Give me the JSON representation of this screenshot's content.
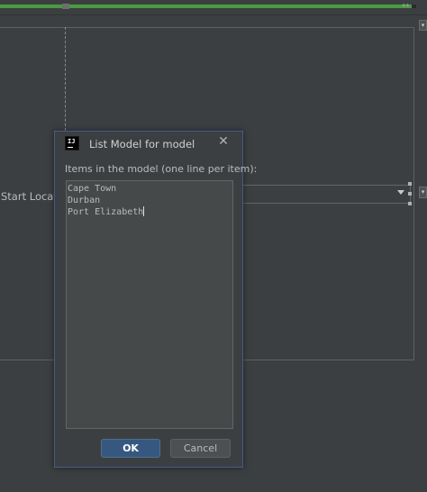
{
  "progress": {
    "fraction": 0.99
  },
  "dialog": {
    "title": "List Model for model",
    "app_icon_text": "IJ",
    "items_label": "Items in the model (one line per item):",
    "items_lines": [
      "Cape Town",
      "Durban",
      "Port Elizabeth"
    ],
    "ok_label": "OK",
    "cancel_label": "Cancel",
    "close_icon": "close-icon"
  },
  "form": {
    "start_location_label": "Start Locatio",
    "combo_icon": "chevron-down-icon"
  },
  "colors": {
    "progress_green": "#4a9a3f",
    "ok_blue": "#365880",
    "background": "#3b3f41"
  }
}
